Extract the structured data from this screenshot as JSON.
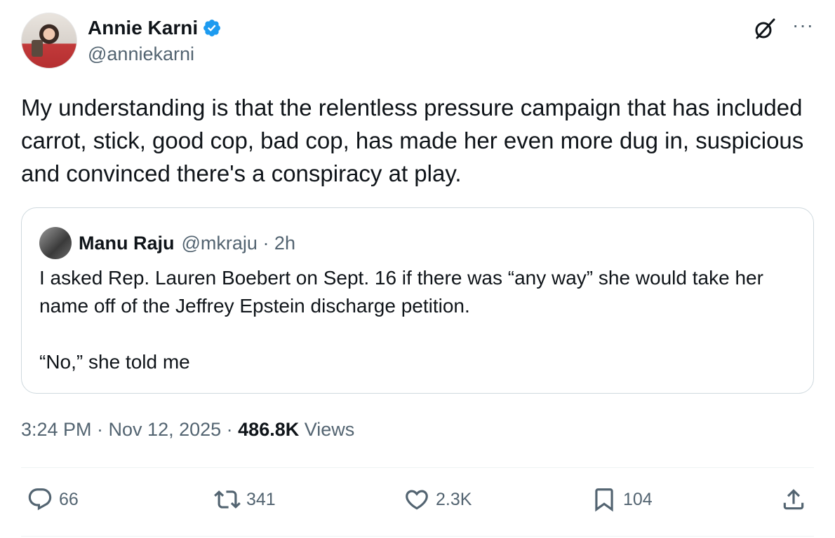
{
  "author": {
    "display_name": "Annie Karni",
    "handle": "@anniekarni",
    "verified": true
  },
  "tweet": {
    "text": "My understanding is that the relentless pressure campaign that has included carrot, stick, good cop, bad cop, has made her even more dug in, suspicious and convinced there's a conspiracy at play."
  },
  "quote": {
    "display_name": "Manu Raju",
    "handle_time": "@mkraju · 2h",
    "paragraph1": "I asked Rep. Lauren Boebert on Sept. 16 if there was “any way” she would take her name off of the Jeffrey Epstein discharge petition.",
    "paragraph2": "“No,” she told me"
  },
  "meta": {
    "time_date": "3:24 PM · Nov 12, 2025 · ",
    "views_count": "486.8K",
    "views_label": " Views"
  },
  "actions": {
    "replies": "66",
    "reposts": "341",
    "likes": "2.3K",
    "bookmarks": "104"
  },
  "colors": {
    "accent": "#1d9bf0",
    "secondary_text": "#536471",
    "border": "#cfd9de"
  },
  "icons": [
    "verified-badge-icon",
    "grok-icon",
    "more-icon",
    "reply-icon",
    "repost-icon",
    "like-icon",
    "bookmark-icon",
    "share-icon"
  ]
}
